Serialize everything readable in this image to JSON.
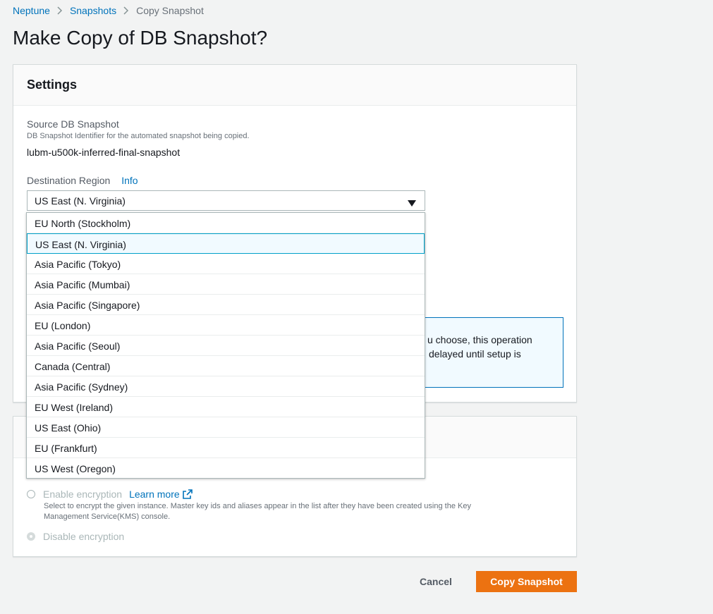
{
  "breadcrumb": [
    "Neptune",
    "Snapshots",
    "Copy Snapshot"
  ],
  "page_title": "Make Copy of DB Snapshot?",
  "settings": {
    "title": "Settings",
    "source_label": "Source DB Snapshot",
    "source_desc": "DB Snapshot Identifier for the automated snapshot being copied.",
    "source_value": "lubm-u500k-inferred-final-snapshot",
    "region_label": "Destination Region",
    "region_info": "Info",
    "region_selected": "US East (N. Virginia)",
    "alert_line1": "u choose, this operation",
    "alert_line2": "delayed until setup is"
  },
  "region_options": [
    "EU North (Stockholm)",
    "US East (N. Virginia)",
    "Asia Pacific (Tokyo)",
    "Asia Pacific (Mumbai)",
    "Asia Pacific (Singapore)",
    "EU (London)",
    "Asia Pacific (Seoul)",
    "Canada (Central)",
    "Asia Pacific (Sydney)",
    "EU West (Ireland)",
    "US East (Ohio)",
    "EU (Frankfurt)",
    "US West (Oregon)"
  ],
  "encryption": {
    "enable_label": "Enable encryption",
    "learn_more": "Learn more",
    "enable_desc_line1": "Select to encrypt the given instance. Master key ids and aliases appear in the list after they have been created using the Key",
    "enable_desc_line2": "Management Service(KMS) console.",
    "disable_label": "Disable encryption"
  },
  "footer": {
    "cancel": "Cancel",
    "copy": "Copy Snapshot"
  },
  "icons": [
    "chevron-right-icon",
    "caret-down-icon",
    "external-link-icon"
  ],
  "colors": {
    "link": "#0073bb",
    "primary": "#ec7211",
    "selected_border": "#00a1c9"
  }
}
